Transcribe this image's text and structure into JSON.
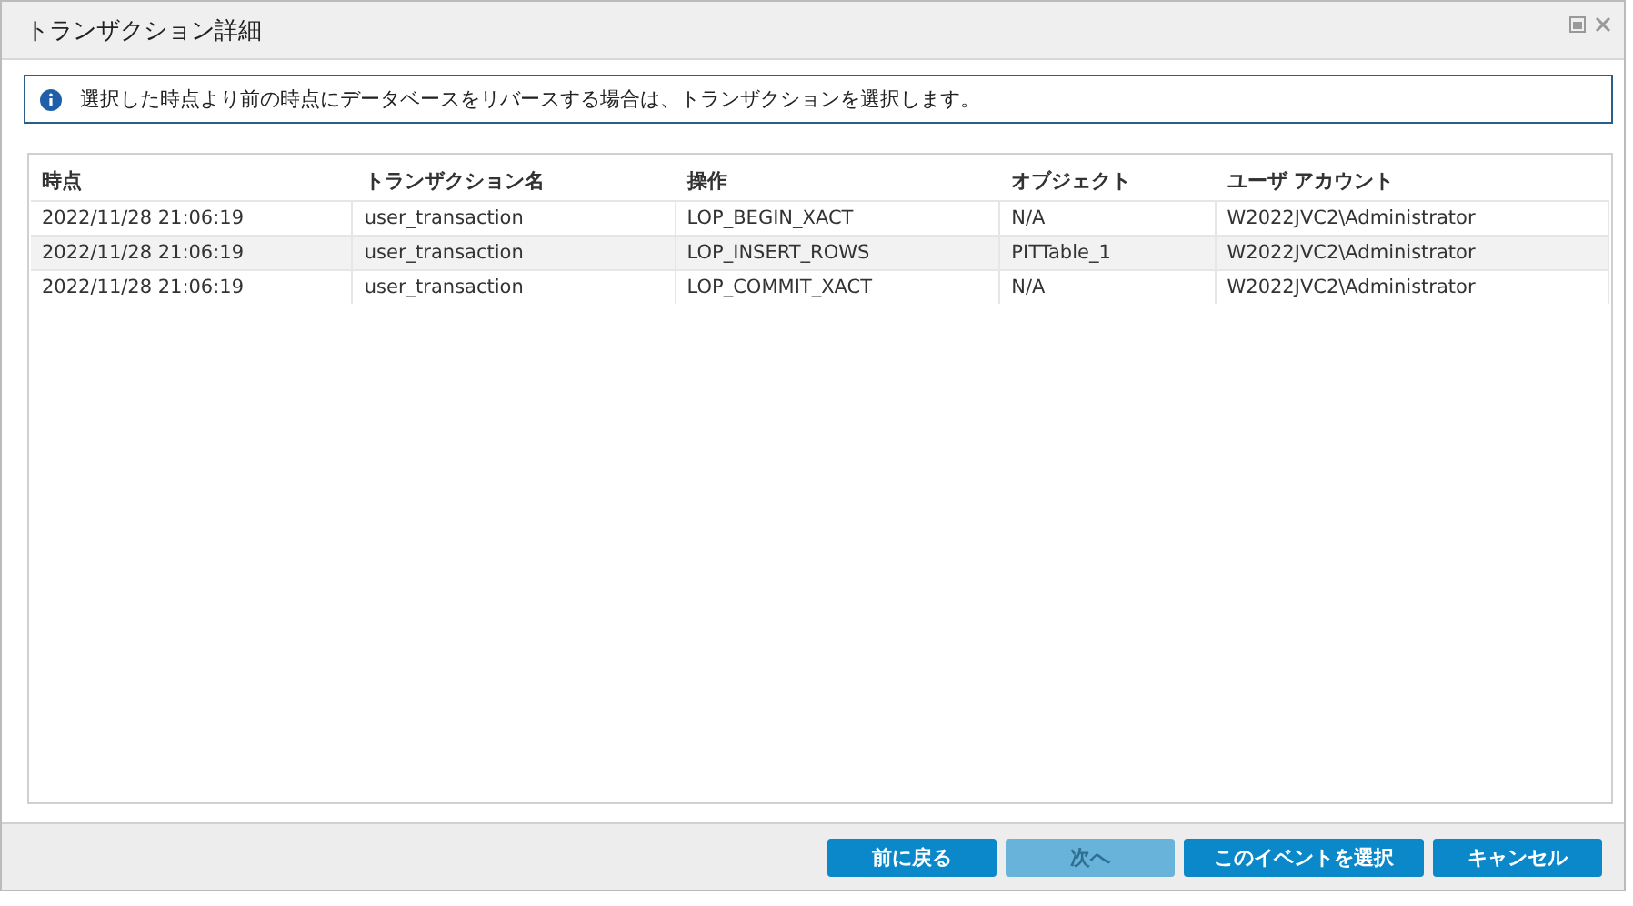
{
  "window": {
    "title": "トランザクション詳細"
  },
  "info": {
    "message": "選択した時点より前の時点にデータベースをリバースする場合は、トランザクションを選択します。"
  },
  "table": {
    "columns": [
      "時点",
      "トランザクション名",
      "操作",
      "オブジェクト",
      "ユーザ アカウント"
    ],
    "rows": [
      [
        "2022/11/28 21:06:19",
        "user_transaction",
        "LOP_BEGIN_XACT",
        "N/A",
        "W2022JVC2\\Administrator"
      ],
      [
        "2022/11/28 21:06:19",
        "user_transaction",
        "LOP_INSERT_ROWS",
        "PITTable_1",
        "W2022JVC2\\Administrator"
      ],
      [
        "2022/11/28 21:06:19",
        "user_transaction",
        "LOP_COMMIT_XACT",
        "N/A",
        "W2022JVC2\\Administrator"
      ]
    ]
  },
  "buttons": [
    {
      "label": "前に戻る",
      "disabled": false
    },
    {
      "label": "次へ",
      "disabled": true
    },
    {
      "label": "このイベントを選択",
      "disabled": false
    },
    {
      "label": "キャンセル",
      "disabled": false
    }
  ]
}
